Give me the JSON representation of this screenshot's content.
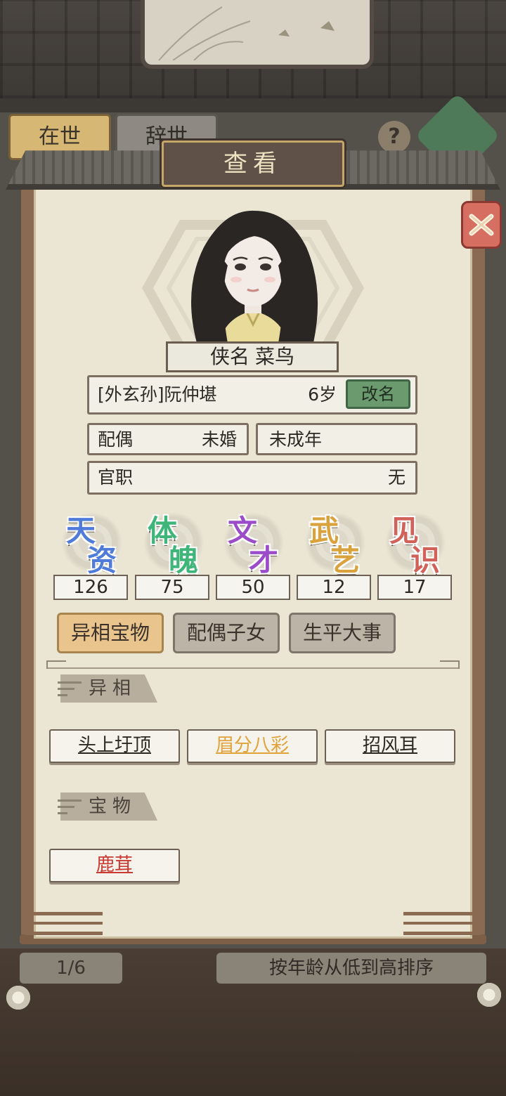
{
  "background": {
    "tabs": [
      "在世",
      "辞世"
    ],
    "help_symbol": "?",
    "pager": "1/6",
    "sort_label": "按年龄从低到高排序"
  },
  "dialog": {
    "title": "查看",
    "close_icon": "close-x-icon"
  },
  "character": {
    "title_label": "侠名",
    "title_value": "菜鸟",
    "relation_name": "[外玄孙]阮仲堪",
    "age": "6岁",
    "rename_button": "改名",
    "spouse_label": "配偶",
    "spouse_value": "未婚",
    "maturity": "未成年",
    "office_label": "官职",
    "office_value": "无"
  },
  "stats": [
    {
      "label": "天资",
      "chars": [
        "天",
        "资"
      ],
      "value": "126",
      "color": "#4f7bd9"
    },
    {
      "label": "体魄",
      "chars": [
        "体",
        "魄"
      ],
      "value": "75",
      "color": "#3fb57a"
    },
    {
      "label": "文才",
      "chars": [
        "文",
        "才"
      ],
      "value": "50",
      "color": "#9b4cc9"
    },
    {
      "label": "武艺",
      "chars": [
        "武",
        "艺"
      ],
      "value": "12",
      "color": "#d9a23c"
    },
    {
      "label": "见识",
      "chars": [
        "见",
        "识"
      ],
      "value": "17",
      "color": "#d1625a"
    }
  ],
  "tabs": [
    {
      "label": "异相宝物",
      "active": true
    },
    {
      "label": "配偶子女",
      "active": false
    },
    {
      "label": "生平大事",
      "active": false
    }
  ],
  "traits_section": {
    "title": "异相",
    "items": [
      {
        "label": "头上圩顶",
        "color": "#2d2824"
      },
      {
        "label": "眉分八彩",
        "color": "#e0a23a"
      },
      {
        "label": "招风耳",
        "color": "#2d2824"
      }
    ]
  },
  "treasures_section": {
    "title": "宝物",
    "items": [
      {
        "label": "鹿茸",
        "color": "#c83a32"
      }
    ]
  }
}
